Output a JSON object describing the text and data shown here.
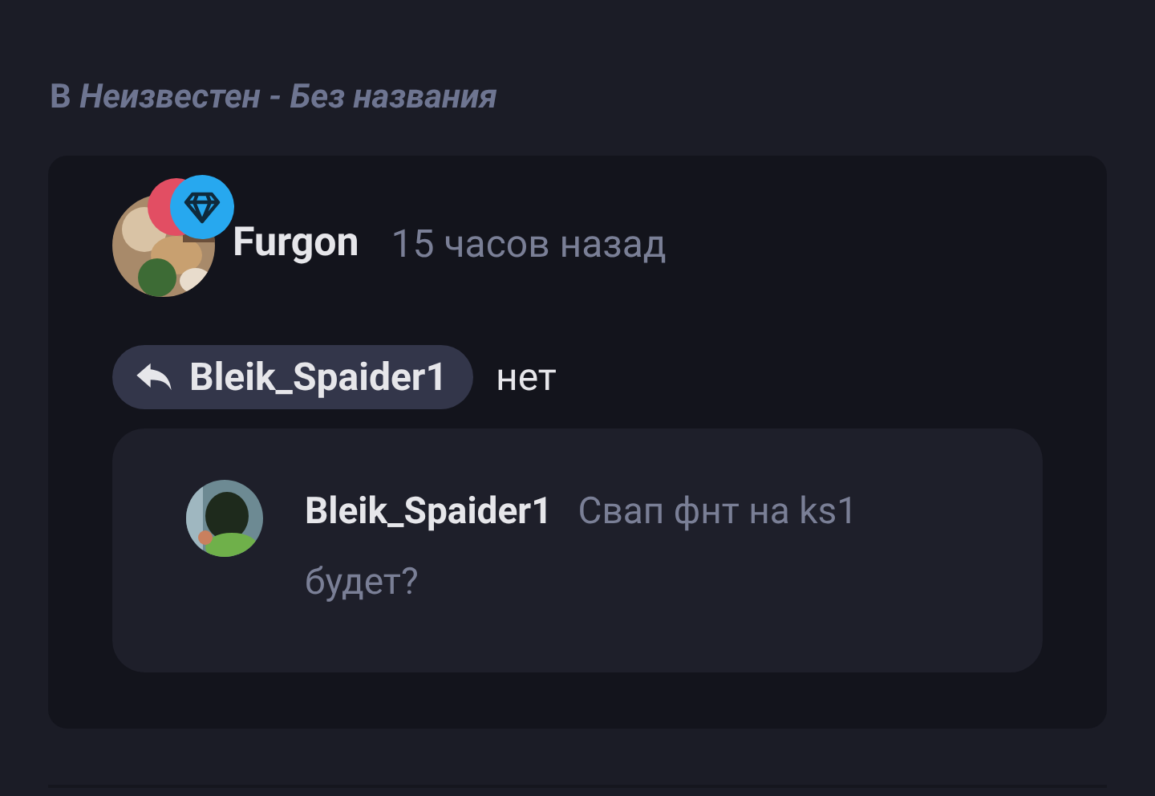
{
  "context": {
    "title": "В *Неизвестен - Без названия*"
  },
  "comment": {
    "author": "Furgon",
    "time": "15 часов назад",
    "reply_to": "Bleik_Spaider1",
    "text": "нет",
    "quote": {
      "author": "Bleik_Spaider1",
      "text": "Свап фнт на ks1 будет?"
    }
  }
}
